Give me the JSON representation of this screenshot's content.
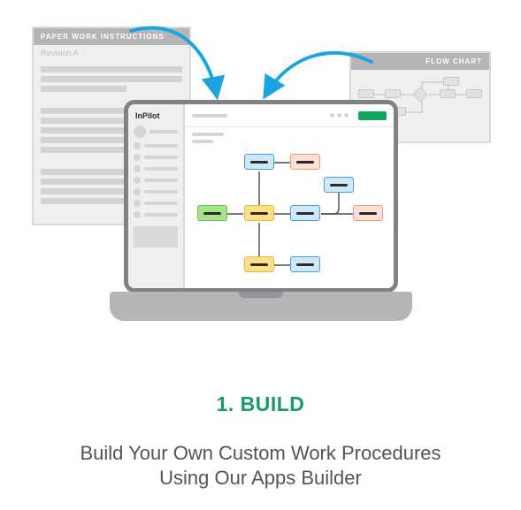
{
  "paper_doc": {
    "title": "PAPER WORK INSTRUCTIONS",
    "revision": "Revision A"
  },
  "flow_chart": {
    "title": "FLOW CHART"
  },
  "laptop_app": {
    "brand": "InPilot"
  },
  "section": {
    "title": "1. BUILD",
    "description_line1": "Build Your Own Custom Work Procedures",
    "description_line2": "Using Our Apps Builder"
  },
  "colors": {
    "accent_green": "#1a9a67",
    "arrow_blue": "#1ca4e2"
  }
}
